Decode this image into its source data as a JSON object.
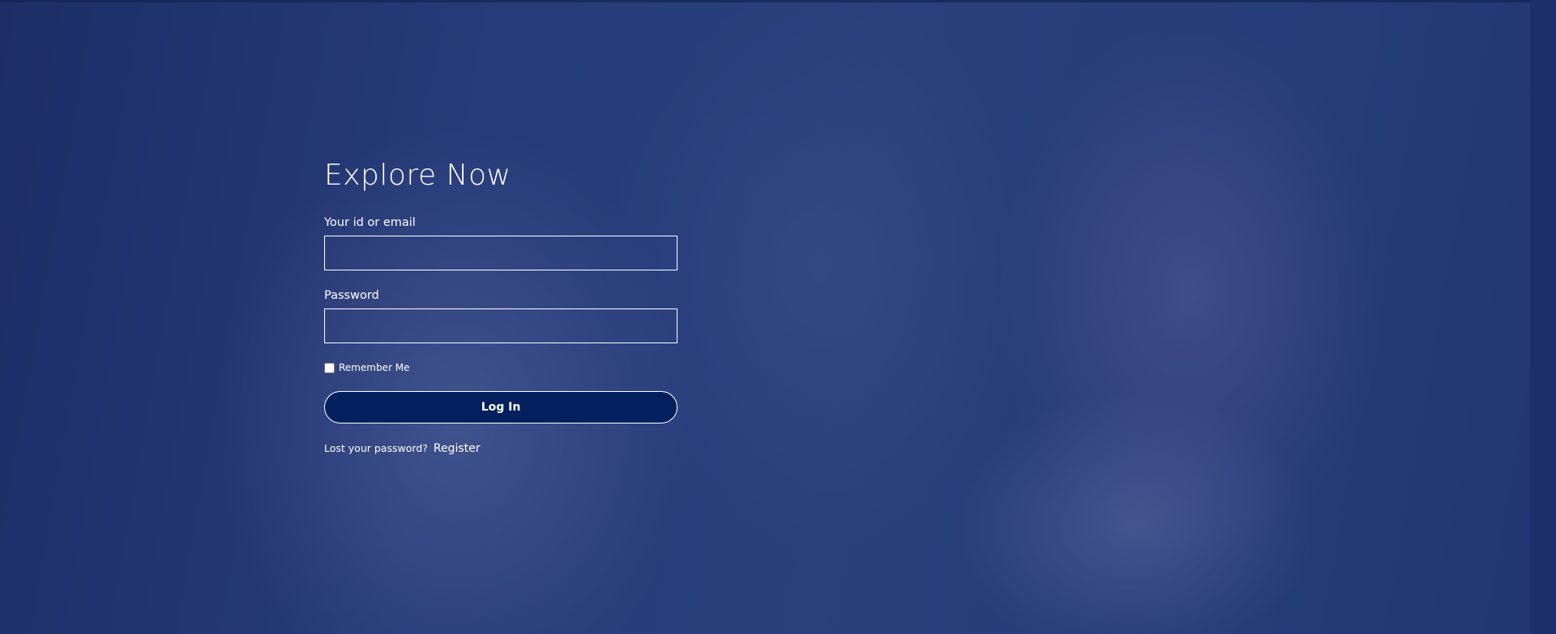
{
  "login": {
    "title": "Explore Now",
    "username_label": "Your id or email",
    "username_value": "",
    "password_label": "Password",
    "password_value": "",
    "remember_label": "Remember Me",
    "remember_checked": false,
    "login_button": "Log In",
    "lost_password_link": "Lost your password?",
    "register_link": "Register"
  },
  "colors": {
    "overlay": "#2b3f78",
    "button_bg": "#02205e",
    "text": "#ffffff"
  }
}
